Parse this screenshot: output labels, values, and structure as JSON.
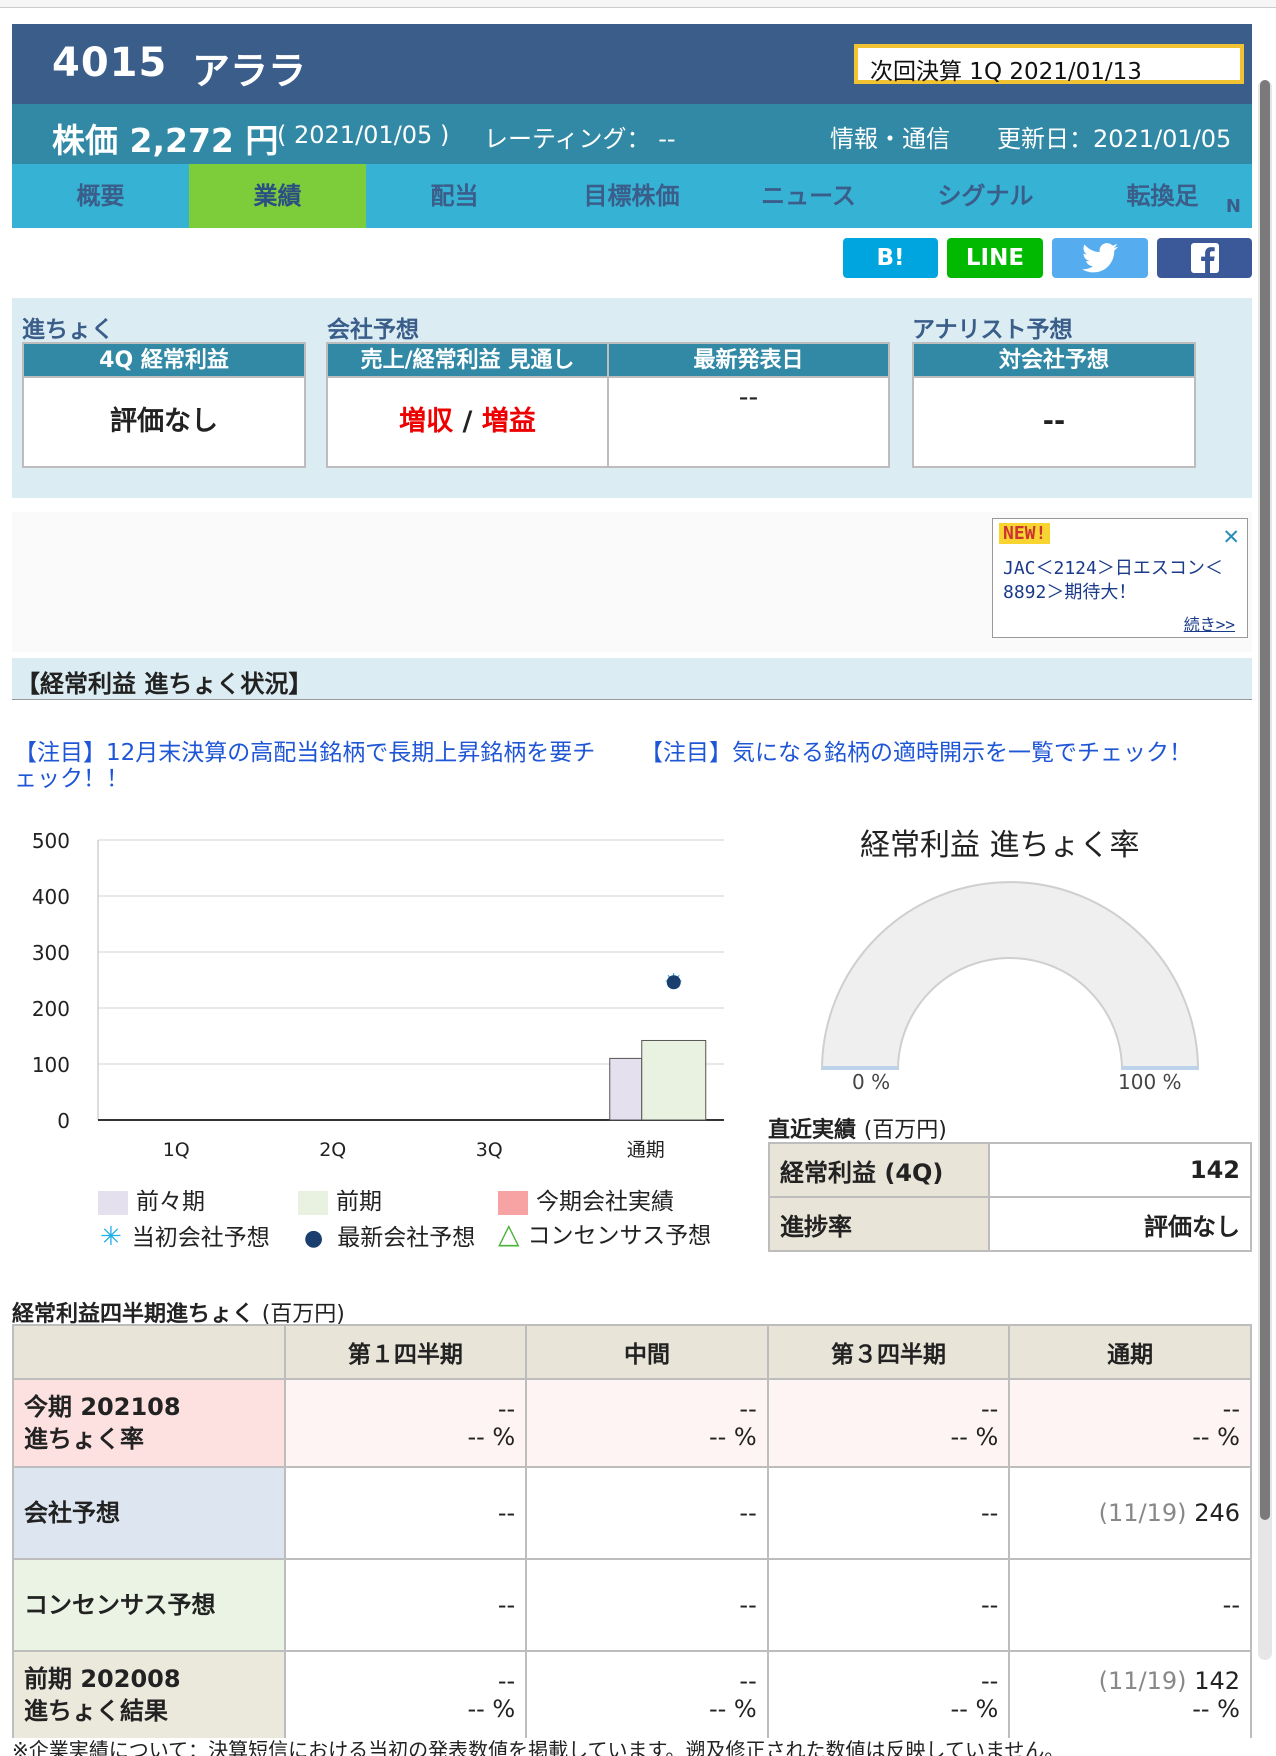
{
  "header": {
    "code": "4015",
    "name": "アララ",
    "next_earnings": "次回決算 1Q 2021/01/13"
  },
  "price": {
    "label": "株価 2,272 円",
    "date": "( 2021/01/05 )",
    "rating": "レーティング： --",
    "sector": "情報・通信",
    "updated": "更新日：2021/01/05"
  },
  "tabs": [
    {
      "label": "概要"
    },
    {
      "label": "業績",
      "active": true
    },
    {
      "label": "配当"
    },
    {
      "label": "目標株価"
    },
    {
      "label": "ニュース"
    },
    {
      "label": "シグナル"
    },
    {
      "label": "転換足",
      "sup": "N"
    }
  ],
  "share": {
    "hatena": "B!",
    "line": "LINE",
    "twitter_icon": "twitter-bird-icon",
    "facebook_icon": "f"
  },
  "progress": {
    "label1": "進ちょく",
    "label2": "会社予想",
    "label3": "アナリスト予想",
    "box1": {
      "head": "4Q 経常利益",
      "body": "評価なし"
    },
    "box2": {
      "head": "売上/経常利益 見通し",
      "body_a": "増収",
      "sep": " / ",
      "body_b": "増益"
    },
    "box3": {
      "head": "最新発表日",
      "body": "--"
    },
    "box4": {
      "head": "対会社予想",
      "body": "--"
    }
  },
  "news": {
    "new": "NEW!",
    "body": "JAC＜2124＞日エスコン＜8892＞期待大！",
    "more": "続き>>"
  },
  "section_title": "【経常利益 進ちょく状況】",
  "notices": [
    "【注目】12月末決算の高配当銘柄で長期上昇銘柄を要チェック！！",
    "【注目】気になる銘柄の適時開示を一覧でチェック！"
  ],
  "chart_data": {
    "type": "bar",
    "categories": [
      "1Q",
      "2Q",
      "3Q",
      "通期"
    ],
    "ylim": [
      0,
      500
    ],
    "yticks": [
      0,
      100,
      200,
      300,
      400,
      500
    ],
    "series": [
      {
        "name": "前々期",
        "color": "#e4e0ee",
        "values": [
          null,
          null,
          null,
          110
        ]
      },
      {
        "name": "前期",
        "color": "#e9f2e0",
        "values": [
          null,
          null,
          null,
          142
        ]
      },
      {
        "name": "今期会社実績",
        "color": "#f7a3a3",
        "values": [
          null,
          null,
          null,
          null
        ]
      }
    ],
    "markers": [
      {
        "name": "当初会社予想",
        "color": "#1eaee8",
        "symbol": "asterisk",
        "values": [
          null,
          null,
          null,
          246
        ]
      },
      {
        "name": "最新会社予想",
        "color": "#1a3f6e",
        "symbol": "dot",
        "values": [
          null,
          null,
          null,
          246
        ]
      },
      {
        "name": "コンセンサス予想",
        "color": "#4cb33a",
        "symbol": "triangle",
        "values": [
          null,
          null,
          null,
          null
        ]
      }
    ],
    "grid": true
  },
  "gauge": {
    "title": "経常利益 進ちょく率",
    "min_label": "0 %",
    "max_label": "100 %",
    "value": 0
  },
  "recent": {
    "title": "直近実績",
    "unit": "(百万円)",
    "rows": [
      {
        "k": "経常利益 (4Q)",
        "v": "142"
      },
      {
        "k": "進捗率",
        "v": "評価なし"
      }
    ]
  },
  "quarterly": {
    "title": "経常利益四半期進ちょく",
    "unit": "(百万円)",
    "headers": [
      "",
      "第１四半期",
      "中間",
      "第３四半期",
      "通期"
    ],
    "rows": [
      {
        "head1": "今期 202108",
        "head2": "進ちょく率",
        "cells": [
          [
            "--",
            "-- %"
          ],
          [
            "--",
            "-- %"
          ],
          [
            "--",
            "-- %"
          ],
          [
            "--",
            "-- %"
          ]
        ]
      },
      {
        "head1": "会社予想",
        "cells": [
          [
            "--"
          ],
          [
            "--"
          ],
          [
            "--"
          ],
          [
            "(11/19) ",
            "246"
          ]
        ]
      },
      {
        "head1": "コンセンサス予想",
        "cells": [
          [
            "--"
          ],
          [
            "--"
          ],
          [
            "--"
          ],
          [
            "--"
          ]
        ]
      },
      {
        "head1": "前期 202008",
        "head2": "進ちょく結果",
        "cells": [
          [
            "--",
            "-- %"
          ],
          [
            "--",
            "-- %"
          ],
          [
            "--",
            "-- %"
          ],
          [
            "(11/19) ",
            "142",
            "-- %"
          ]
        ]
      }
    ]
  },
  "footnote": "※企業実績について：決算短信における当初の発表数値を掲載しています。遡及修正された数値は反映していません。"
}
